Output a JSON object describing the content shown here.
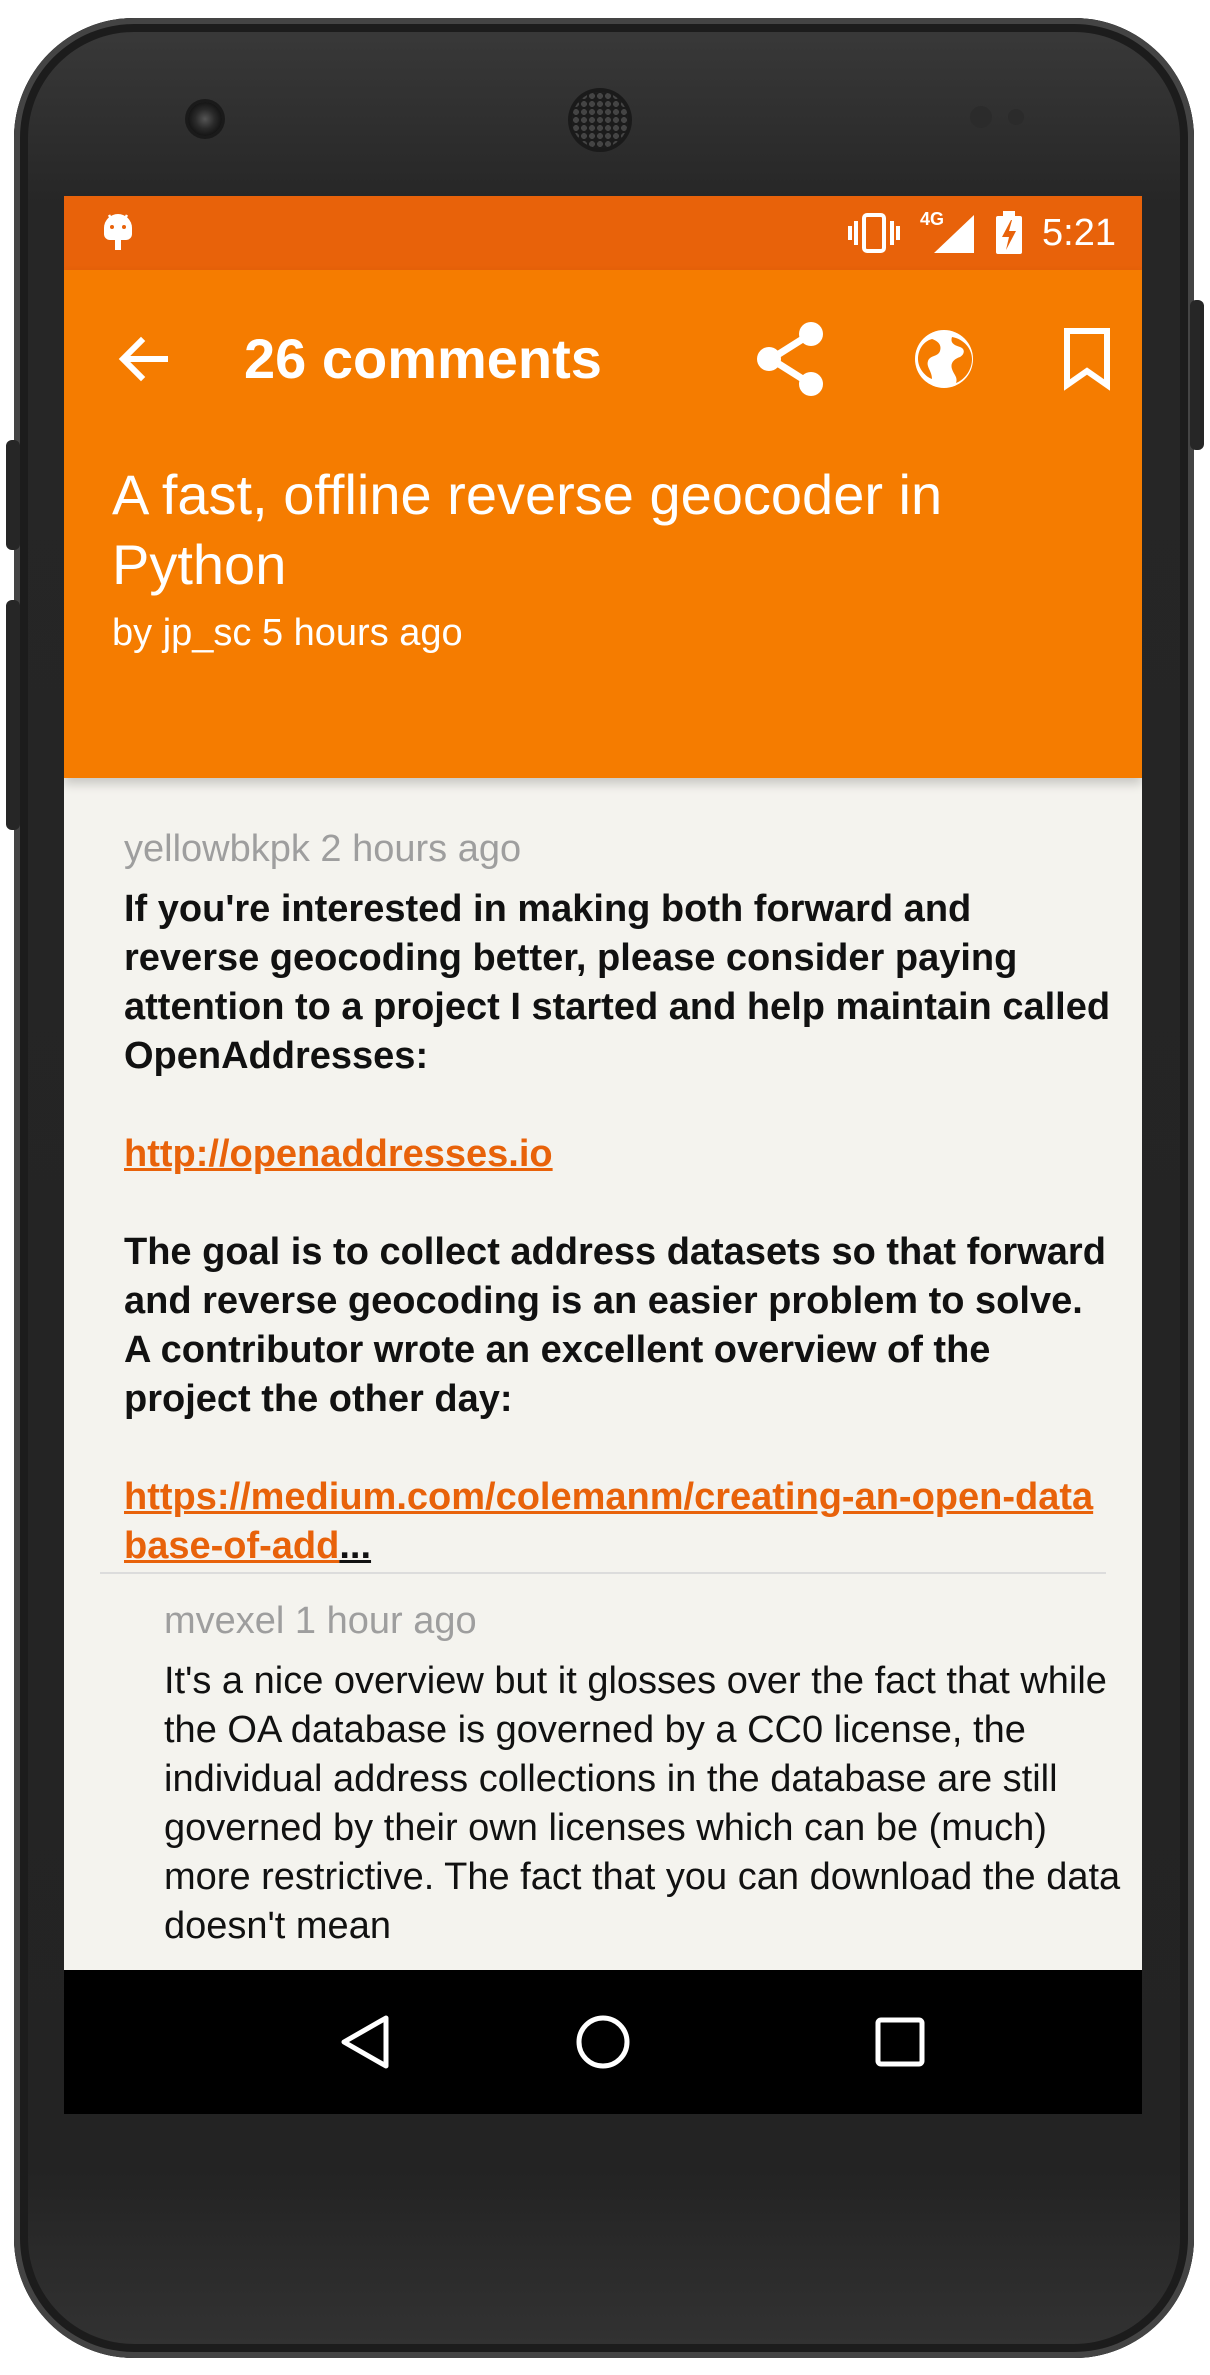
{
  "status_bar": {
    "time": "5:21",
    "network_label": "4G",
    "icons": [
      "android-debug-icon",
      "vibrate-icon",
      "signal-icon",
      "battery-charging-icon"
    ]
  },
  "toolbar": {
    "title": "26 comments",
    "icons": [
      "back-arrow-icon",
      "share-icon",
      "globe-icon",
      "bookmark-icon"
    ]
  },
  "story": {
    "title": "A fast, offline reverse geocoder in Python",
    "meta": "by jp_sc 5 hours ago"
  },
  "comments": [
    {
      "author_line": "yellowbkpk 2 hours ago",
      "paragraphs": [
        "If you're interested in making both forward and reverse geocoding better, please consider paying attention to a project I started and help maintain called OpenAddresses:",
        "http://openaddresses.io",
        "The goal is to collect address datasets so that forward and reverse geocoding is an easier problem to solve. A contributor wrote an excellent overview of the project the other day:",
        "https://medium.com/colemanm/creating-an-open-database-of-add"
      ],
      "truncation": "..."
    },
    {
      "author_line": "mvexel 1 hour ago",
      "paragraphs": [
        "It's a nice overview but it glosses over the fact that while the OA database is governed by a CC0 license, the individual address collections in the database are still governed by their own licenses which can be (much) more restrictive. The fact that you can download the data doesn't mean"
      ]
    }
  ],
  "nav_bar": {
    "icons": [
      "back-triangle-icon",
      "home-circle-icon",
      "recents-square-icon"
    ]
  },
  "colors": {
    "status_bar": "#e8620a",
    "toolbar": "#f57c00",
    "link": "#e8620a",
    "background": "#f4f3ee"
  }
}
